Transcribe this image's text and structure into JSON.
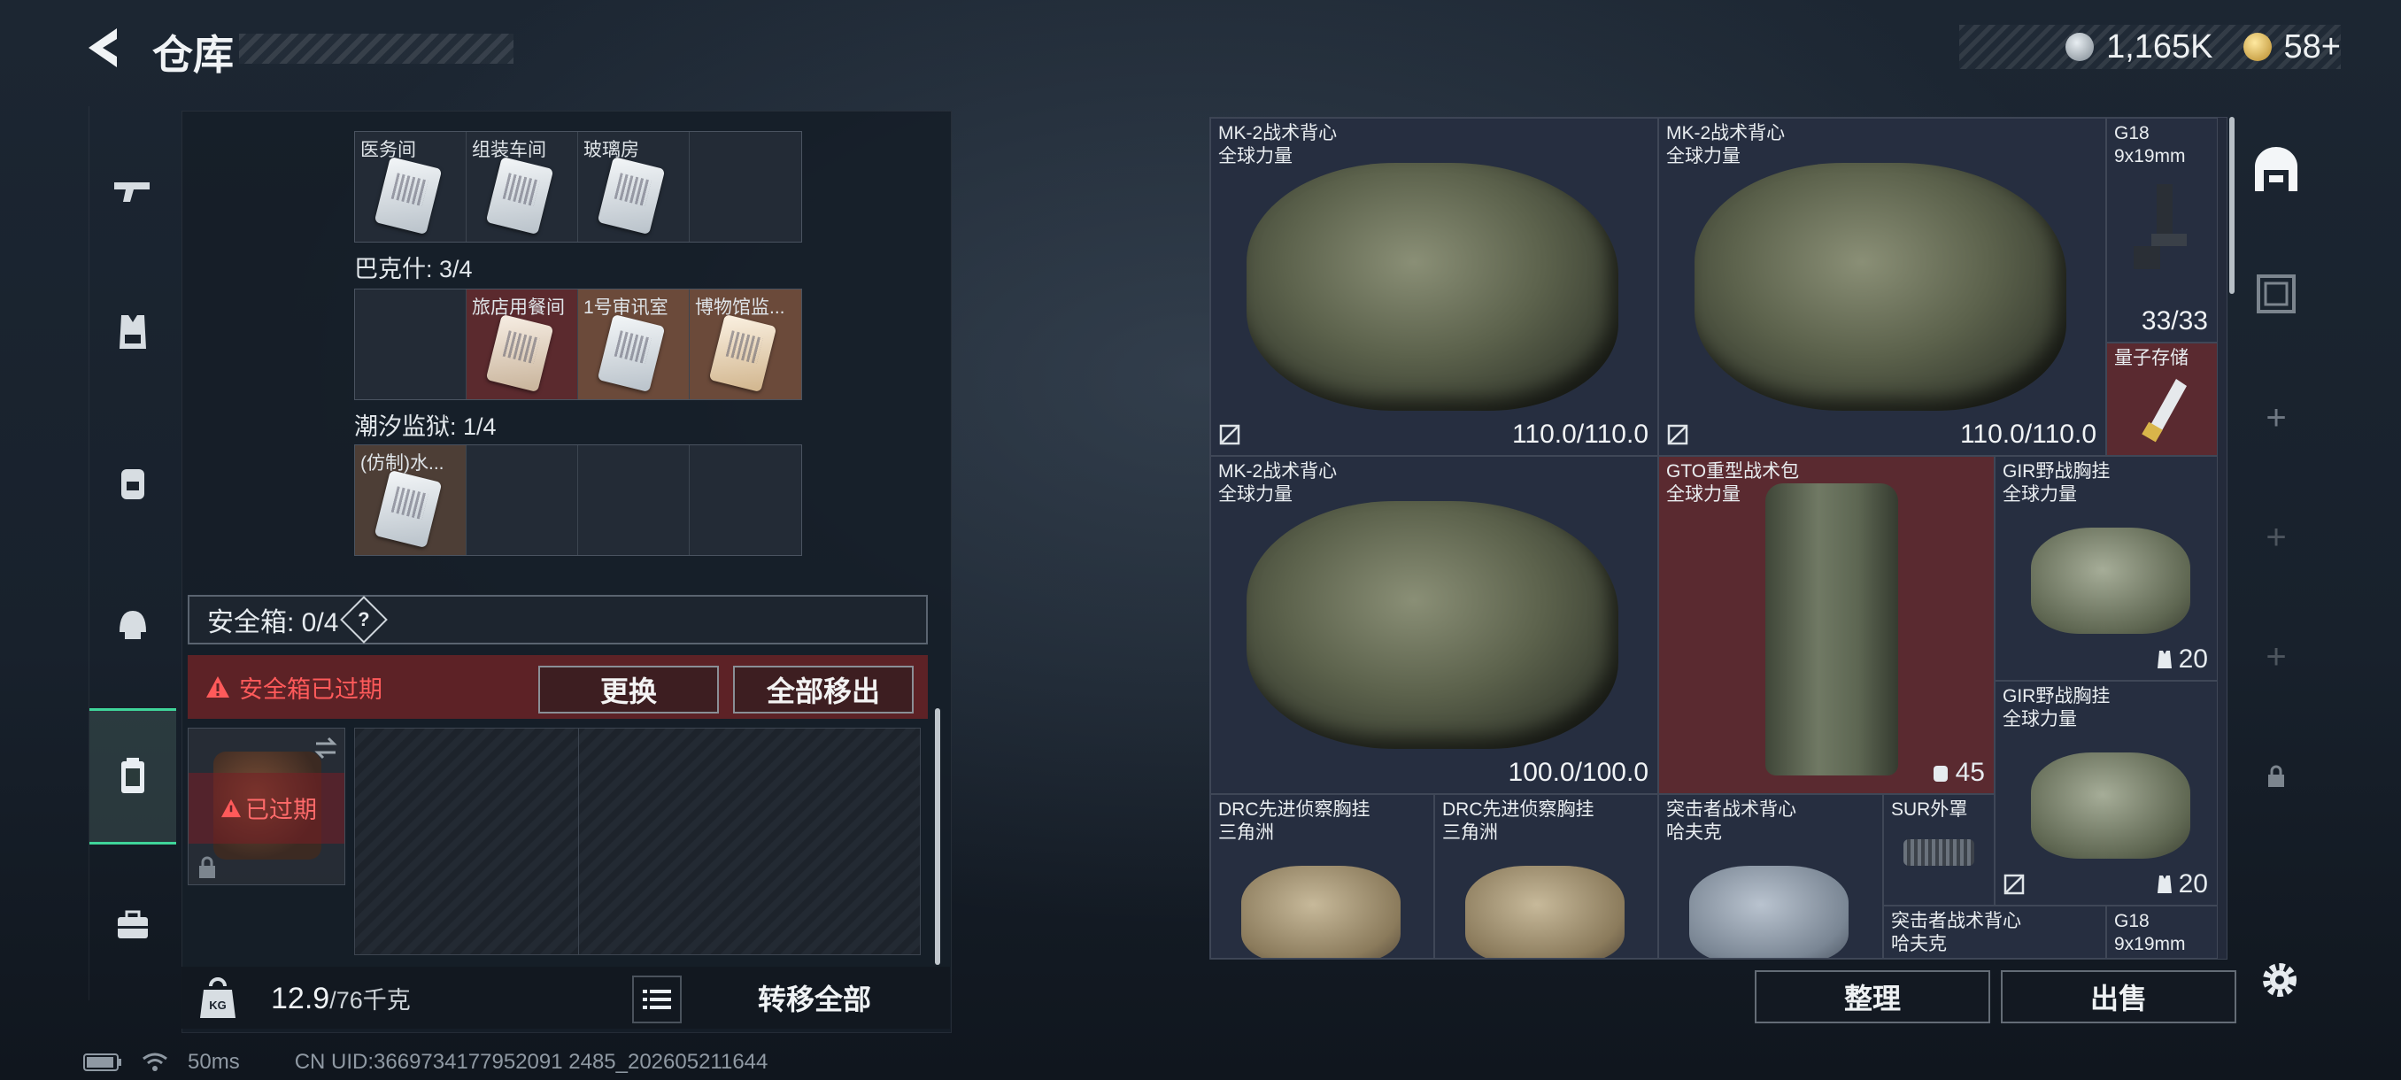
{
  "header": {
    "title": "仓库",
    "silver": "1,165K",
    "gold": "58+"
  },
  "left": {
    "row_top_labels": [
      "医务间",
      "组装车间",
      "玻璃房",
      ""
    ],
    "section2_title": "巴克什: 3/4",
    "row2_labels": [
      "",
      "旅店用餐间",
      "1号审讯室",
      "博物馆监..."
    ],
    "section3_title": "潮汐监狱: 1/4",
    "row3_labels": [
      "(仿制)水...",
      "",
      "",
      ""
    ],
    "safe_label": "安全箱: 0/4",
    "safe_help": "?",
    "expired_msg": "安全箱已过期",
    "replace_btn": "更换",
    "move_all_btn": "全部移出",
    "slot_expired": "已过期",
    "weight_value": "12.9",
    "weight_limit": "/76千克",
    "transfer_btn": "转移全部"
  },
  "status": {
    "ping": "50ms",
    "uid": "CN UID:3669734177952091 2485_202605211644"
  },
  "inventory": {
    "items": [
      {
        "name": "MK-2战术背心",
        "sub": "全球力量",
        "value": "110.0/110.0"
      },
      {
        "name": "MK-2战术背心",
        "sub": "全球力量",
        "value": "110.0/110.0"
      },
      {
        "name": "G18",
        "sub": "9x19mm",
        "value": "33/33"
      },
      {
        "name": "量子存储",
        "sub": "",
        "value": ""
      },
      {
        "name": "MK-2战术背心",
        "sub": "全球力量",
        "value": "100.0/100.0"
      },
      {
        "name": "GTO重型战术包",
        "sub": "全球力量",
        "value": "45"
      },
      {
        "name": "GIR野战胸挂",
        "sub": "全球力量",
        "value": "20"
      },
      {
        "name": "GIR野战胸挂",
        "sub": "全球力量",
        "value": "20"
      },
      {
        "name": "DRC先进侦察胸挂",
        "sub": "三角洲",
        "value": ""
      },
      {
        "name": "DRC先进侦察胸挂",
        "sub": "三角洲",
        "value": ""
      },
      {
        "name": "突击者战术背心",
        "sub": "哈夫克",
        "value": ""
      },
      {
        "name": "SUR外罩",
        "sub": "",
        "value": ""
      },
      {
        "name": "突击者战术背心",
        "sub": "哈夫克",
        "value": ""
      },
      {
        "name": "G18",
        "sub": "9x19mm",
        "value": ""
      }
    ],
    "sort_btn": "整理",
    "sell_btn": "出售"
  },
  "colors": {
    "accent_green": "#3fd59a",
    "danger_red": "#ff5a5a",
    "expired_bg": "#5d2226"
  }
}
